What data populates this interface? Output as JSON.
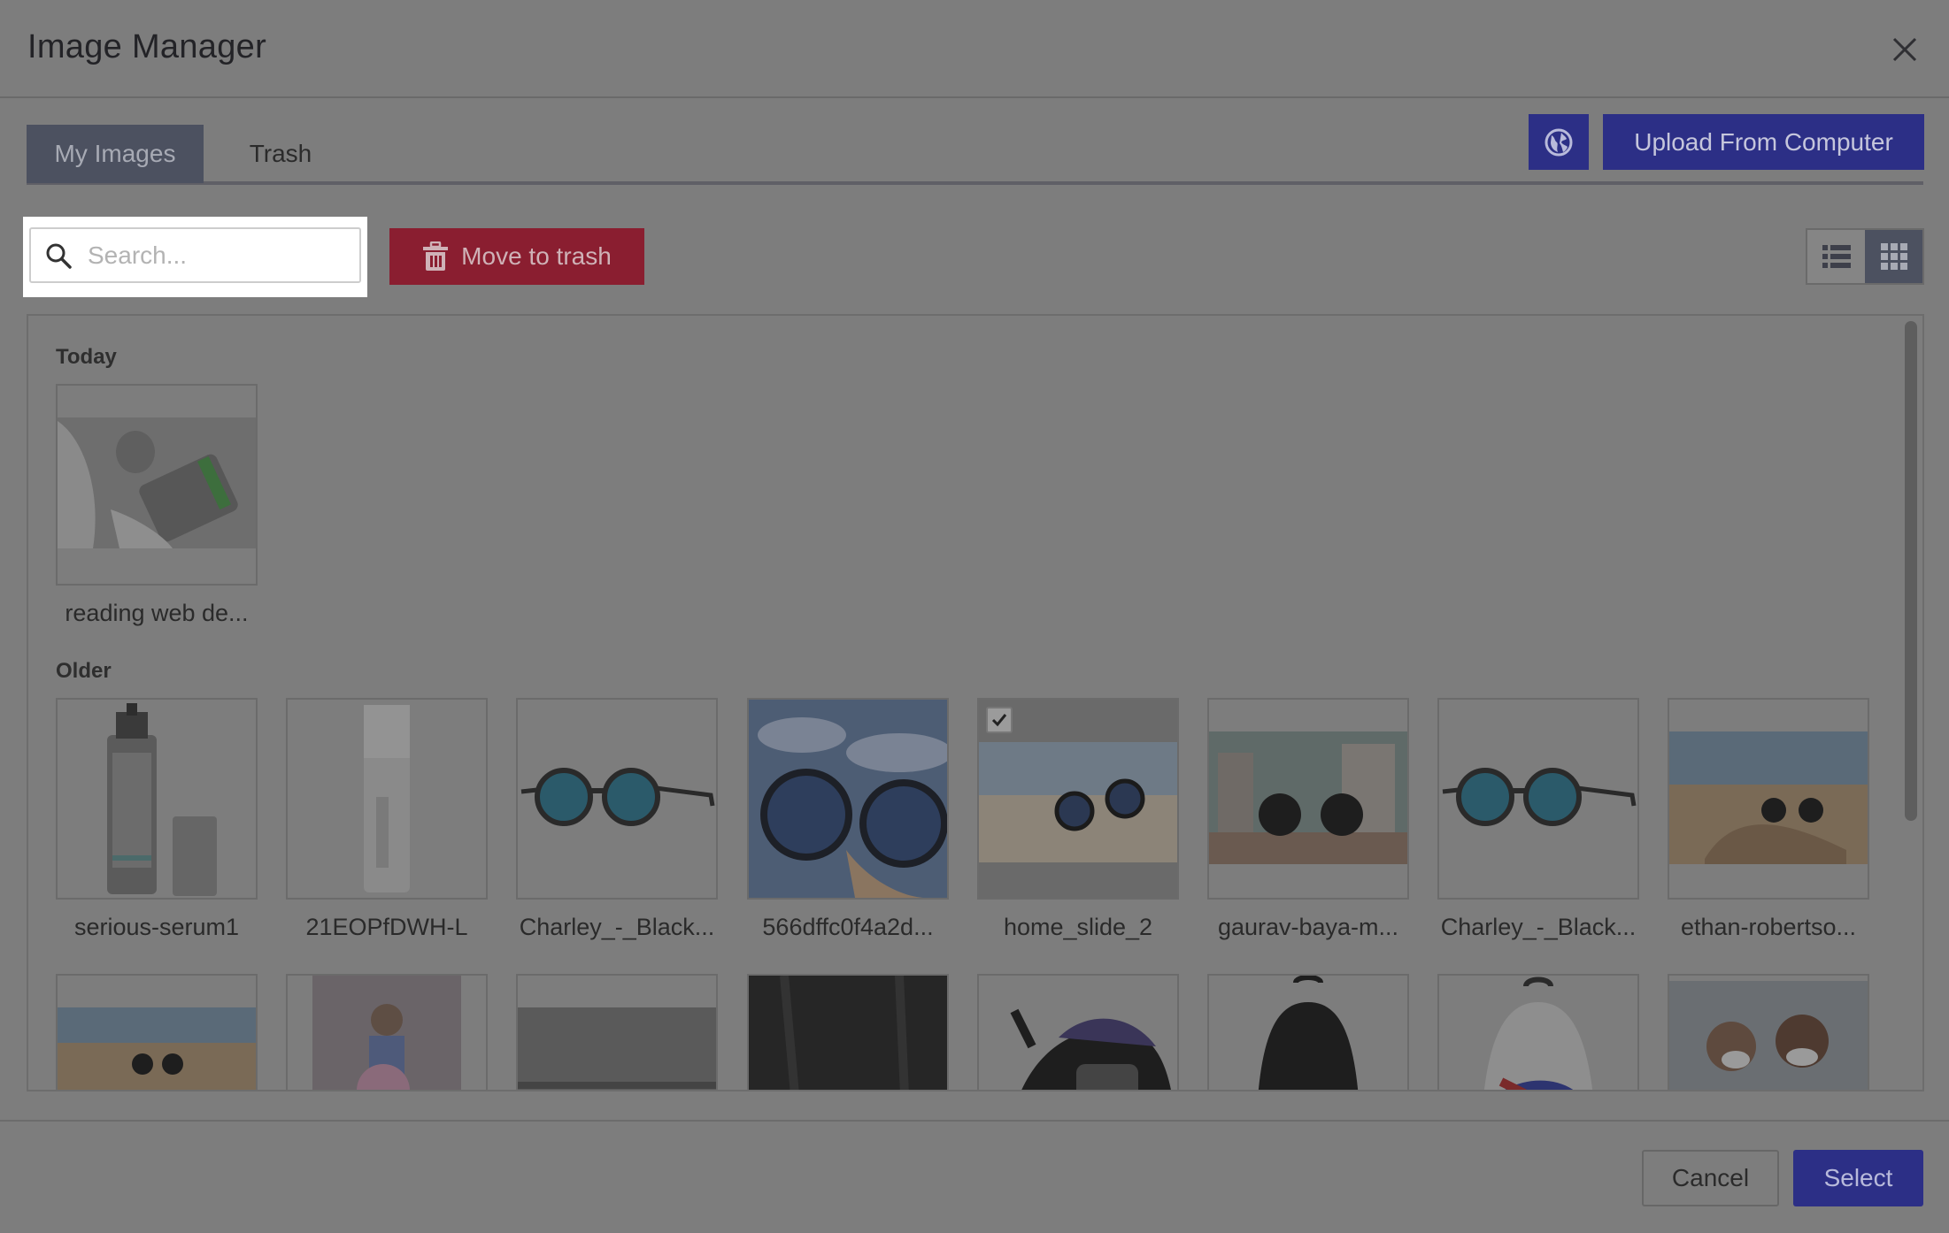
{
  "dialog": {
    "title": "Image Manager"
  },
  "tabs": [
    {
      "label": "My Images",
      "active": true
    },
    {
      "label": "Trash",
      "active": false
    }
  ],
  "toolbar": {
    "upload_label": "Upload From Computer",
    "search_placeholder": "Search...",
    "move_to_trash_label": "Move to trash",
    "view_modes": [
      "list",
      "grid"
    ],
    "active_view": "grid"
  },
  "sections": {
    "today": {
      "title": "Today",
      "items": [
        {
          "name": "reading web de...",
          "selected": false
        }
      ]
    },
    "older": {
      "title": "Older",
      "items": [
        {
          "name": "serious-serum1",
          "selected": false
        },
        {
          "name": "21EOPfDWH-L",
          "selected": false
        },
        {
          "name": "Charley_-_Black...",
          "selected": false
        },
        {
          "name": "566dffc0f4a2d...",
          "selected": false
        },
        {
          "name": "home_slide_2",
          "selected": true
        },
        {
          "name": "gaurav-baya-m...",
          "selected": false
        },
        {
          "name": "Charley_-_Black...",
          "selected": false
        },
        {
          "name": "ethan-robertso...",
          "selected": false
        }
      ]
    }
  },
  "footer": {
    "cancel_label": "Cancel",
    "select_label": "Select"
  },
  "colors": {
    "overlay": "#7d7d7d",
    "primary": "#2c2f86",
    "danger": "#8a1e30",
    "tab_active": "#4c5160"
  }
}
